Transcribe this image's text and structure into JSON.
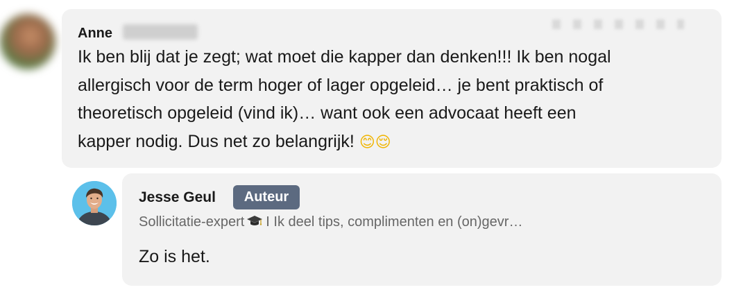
{
  "comment": {
    "author_first_name": "Anne",
    "text_lines": [
      "Ik ben blij dat je zegt; wat moet die kapper dan denken!!! Ik ben nogal",
      "allergisch voor de term hoger of lager opgeleid… je bent praktisch of",
      "theoretisch opgeleid (vind ik)… want ook een advocaat heeft een",
      "kapper nodig. Dus net zo belangrijk! "
    ],
    "emojis": "😊😌"
  },
  "reply": {
    "author_name": "Jesse Geul",
    "badge_label": "Auteur",
    "headline_before_icon": "Sollicitatie-expert",
    "headline_icon": "graduation-cap-icon",
    "headline_after_icon": "I Ik deel tips, complimenten en (on)gevr…",
    "text": "Zo is het."
  },
  "colors": {
    "bubble_background": "#f2f2f2",
    "badge_background": "#5c6a80",
    "headline_text": "#666666",
    "avatar_background": "#5cc0ea"
  }
}
